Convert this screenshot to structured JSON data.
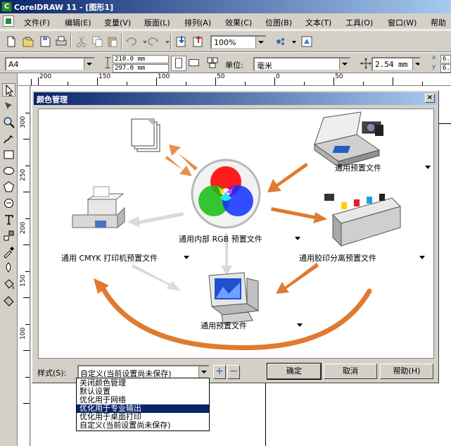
{
  "window": {
    "title": "CorelDRAW 11 - [图形1]"
  },
  "menu": {
    "items": [
      "文件(F)",
      "编辑(E)",
      "变量(V)",
      "版面(L)",
      "排列(A)",
      "效果(C)",
      "位图(B)",
      "文本(T)",
      "工具(O)",
      "窗口(W)",
      "帮助"
    ]
  },
  "toolbar": {
    "zoom_value": "100%"
  },
  "property_bar": {
    "page_size": "A4",
    "width": "210.0 mm",
    "height": "297.0 mm",
    "units_label": "单位:",
    "units_value": "毫米",
    "nudge_value": "2.54 mm",
    "x_label": "x",
    "y_label": "y",
    "dup_x": "6.",
    "dup_y": "6."
  },
  "ruler": {
    "h_labels": [
      "200",
      "150",
      "100",
      "50",
      "0",
      "50"
    ],
    "v_labels": [
      "300",
      "250",
      "200",
      "150",
      "100"
    ]
  },
  "dialog": {
    "title": "颜色管理",
    "close": "×",
    "scanner_label": "通用预置文件",
    "rgb_label": "通用内部 RGB 预置文件",
    "printer_label": "通用 CMYK 打印机预置文件",
    "press_label": "通用胶印分离预置文件",
    "monitor_label": "通用预置文件",
    "style_label": "样式(S):",
    "style_value": "自定义(当前设置尚未保存)",
    "add_button": "+",
    "remove_button": "−",
    "ok": "确定",
    "cancel": "取消",
    "help": "帮助(H)"
  },
  "style_options": [
    "关闭颜色管理",
    "默认设置",
    "优化用于网络",
    "优化用于专业输出",
    "优化用于桌面打印",
    "自定义(当前设置尚未保存)"
  ],
  "selected_option_index": 3,
  "colors": {
    "title_blue": "#0a246a",
    "title_light": "#a6caf0",
    "arrow_orange": "#e07a2e",
    "arrow_grey": "#d8d8d8"
  }
}
